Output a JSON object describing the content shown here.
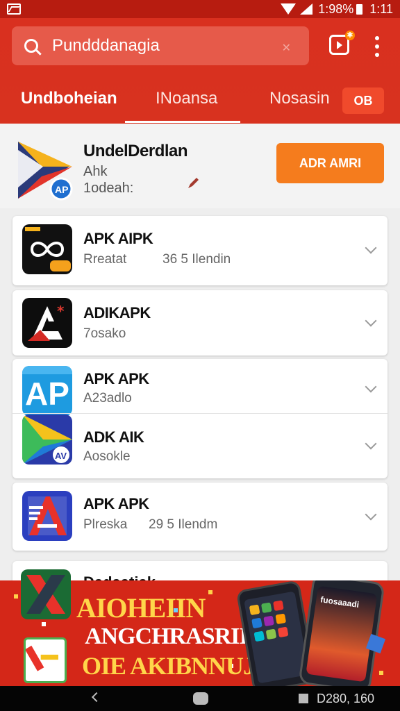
{
  "status_bar": {
    "battery_text": "1:98%",
    "time": "1:11"
  },
  "search": {
    "placeholder": "Pundddanagia"
  },
  "tabs": [
    {
      "label": "Undboheian",
      "active": true
    },
    {
      "label": "INoansa",
      "active": false
    },
    {
      "label": "Nosasin",
      "active": false
    }
  ],
  "tab_badge": "OB",
  "featured": {
    "title": "UndelDerdlan",
    "line1": "Ahk",
    "line2": "1odeah:",
    "button_label": "ADR AMRI"
  },
  "list": [
    {
      "title": "APK AIPK",
      "sub": "Rreatat",
      "meta": "36 5 Ilendin",
      "icon": "infinity-app-icon"
    },
    {
      "title": "ADIKAPK",
      "sub": "7osako",
      "meta": "",
      "icon": "red-a-app-icon"
    },
    {
      "title": "APK APK",
      "sub": "A23adlo",
      "meta": "",
      "icon": "ap-app-icon"
    },
    {
      "title": "ADK AIK",
      "sub": "Aosokle",
      "meta": "",
      "icon": "play-store-icon"
    },
    {
      "title": "APK APK",
      "sub": "Plreska",
      "meta": "29 5 Ilendm",
      "icon": "stripe-a-app-icon"
    },
    {
      "title": "Dadaatiak",
      "sub": "",
      "meta": "",
      "icon": "x-app-icon"
    }
  ],
  "promo": {
    "line1": "AIOHEIIN",
    "line2": "ANGCHRASRIIY",
    "line3": "OIE AKIBNNUJ!",
    "phone_label": "fuosaaadi"
  },
  "nav": {
    "text": "D280, 160"
  },
  "colors": {
    "primary": "#d9301f",
    "accent": "#f57c1d",
    "status_bar": "#b71c10"
  }
}
